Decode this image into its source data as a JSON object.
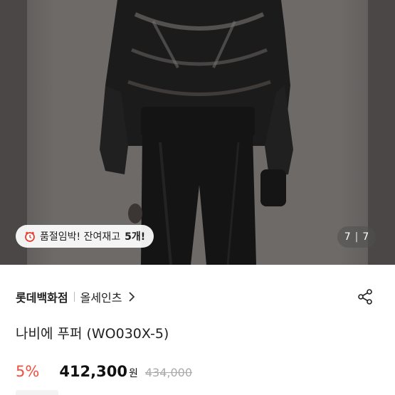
{
  "gallery": {
    "stock_alert_prefix": "품절임박! 잔여재고",
    "stock_alert_count": "5개!",
    "current_page": "7",
    "total_pages": "7"
  },
  "product": {
    "store": "롯데백화점",
    "brand": "올세인츠",
    "title": "나비에 푸퍼 (WO030X-5)",
    "discount": "5%",
    "price": "412,300",
    "currency": "원",
    "original_price": "434,000"
  },
  "icons": {
    "alarm": "alarm-clock-icon",
    "brand_chevron": "chevron-right-icon",
    "share": "share-icon"
  },
  "colors": {
    "discount": "#f0503c",
    "price": "#111111",
    "original_price": "#aaaaaa"
  }
}
